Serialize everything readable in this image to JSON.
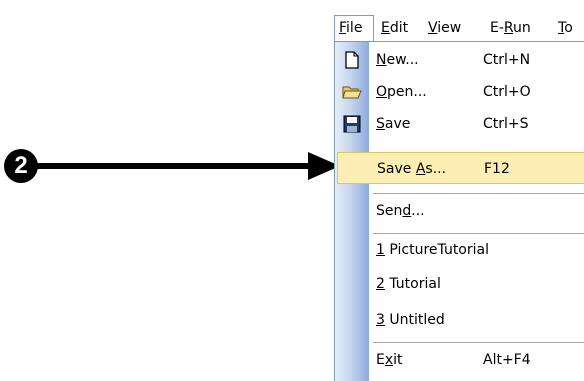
{
  "callout": {
    "number": "2"
  },
  "menubar": {
    "file": {
      "pre": "",
      "key": "F",
      "post": "ile"
    },
    "edit": {
      "pre": "",
      "key": "E",
      "post": "dit"
    },
    "view": {
      "pre": "",
      "key": "V",
      "post": "iew"
    },
    "erun": {
      "pre": "E-",
      "key": "R",
      "post": "un"
    },
    "tools": {
      "pre": "",
      "key": "T",
      "post": "o"
    }
  },
  "file_menu": {
    "new": {
      "pre": "",
      "key": "N",
      "post": "ew...",
      "shortcut": "Ctrl+N",
      "icon": "new-document-icon"
    },
    "open": {
      "pre": "",
      "key": "O",
      "post": "pen...",
      "shortcut": "Ctrl+O",
      "icon": "open-folder-icon"
    },
    "save": {
      "pre": "",
      "key": "S",
      "post": "ave",
      "shortcut": "Ctrl+S",
      "icon": "floppy-disk-icon"
    },
    "save_as": {
      "pre": "Save ",
      "key": "A",
      "post": "s...",
      "shortcut": "F12"
    },
    "send": {
      "pre": "Sen",
      "key": "d",
      "post": "..."
    },
    "recent": [
      {
        "key": "1",
        "post": " PictureTutorial"
      },
      {
        "key": "2",
        "post": " Tutorial"
      },
      {
        "key": "3",
        "post": " Untitled"
      }
    ],
    "exit": {
      "pre": "E",
      "key": "x",
      "post": "it",
      "shortcut": "Alt+F4"
    }
  },
  "colors": {
    "highlight_bg": "#fdeeb4",
    "highlight_border": "#e5c365",
    "gutter": "#8da9dc",
    "menu_border": "#7f9db9"
  }
}
